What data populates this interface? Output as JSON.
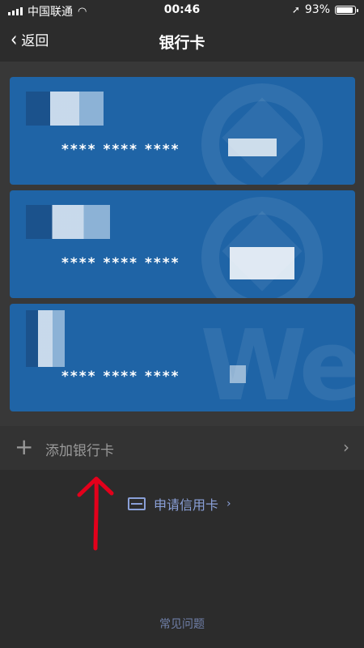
{
  "status_bar": {
    "carrier": "中国联通",
    "time": "00:46",
    "battery": "93%",
    "battery_level": 0.93
  },
  "nav": {
    "back_label": "返回",
    "title": "银行卡"
  },
  "cards": [
    {
      "number_masked": "**** **** ****"
    },
    {
      "number_masked": "**** **** ****"
    },
    {
      "number_masked": "**** **** ****"
    }
  ],
  "add_card": {
    "label": "添加银行卡"
  },
  "apply_credit": {
    "label": "申请信用卡"
  },
  "faq": {
    "label": "常见问题"
  },
  "colors": {
    "card_blue": "#1f64a6",
    "link": "#8aa0d8",
    "annotation_red": "#e3001b"
  }
}
